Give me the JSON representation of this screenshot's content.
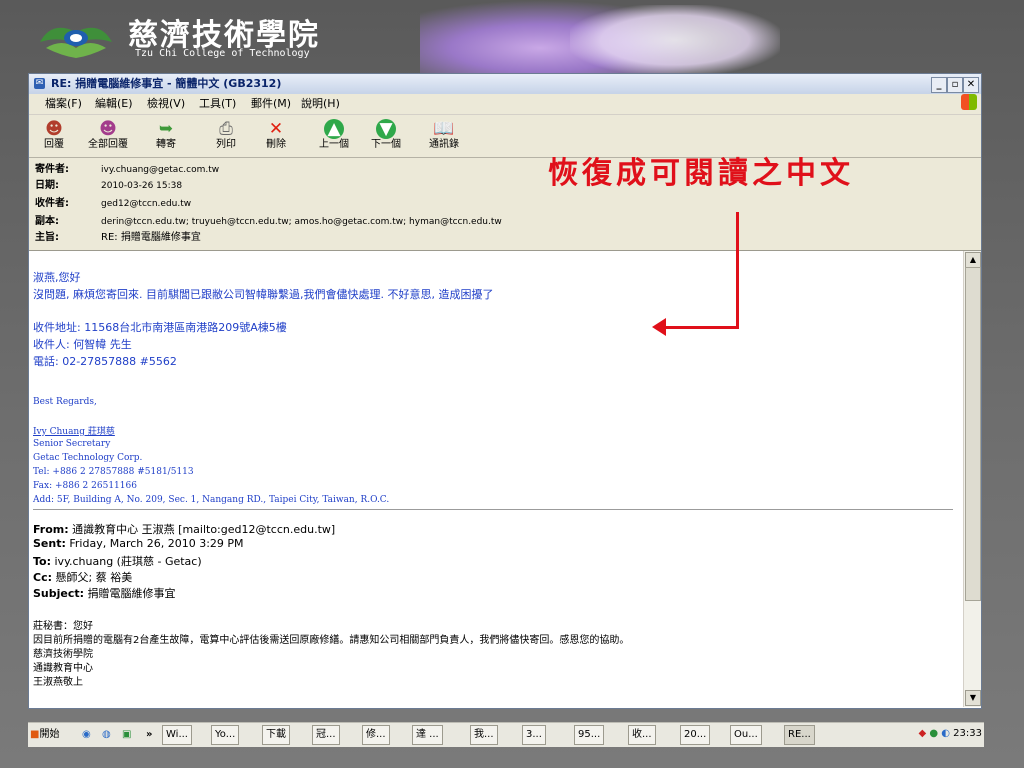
{
  "slide": {
    "logo_cn": "慈濟技術學院",
    "logo_en": "Tzu Chi College of Technology",
    "overlay_text": "恢復成可閱讀之中文"
  },
  "window": {
    "title": "RE: 捐贈電腦維修事宜 - 簡體中文 (GB2312)",
    "controls": [
      "_",
      "▫",
      "✕"
    ]
  },
  "menu": [
    "檔案(F)",
    "編輯(E)",
    "檢視(V)",
    "工具(T)",
    "郵件(M)",
    "說明(H)"
  ],
  "toolbar": [
    {
      "label": "回覆",
      "icon": "reply-icon"
    },
    {
      "label": "全部回覆",
      "icon": "reply-all-icon"
    },
    {
      "label": "轉寄",
      "icon": "forward-icon"
    },
    {
      "label": "列印",
      "icon": "print-icon"
    },
    {
      "label": "刪除",
      "icon": "delete-icon"
    },
    {
      "label": "上一個",
      "icon": "up-arrow-icon"
    },
    {
      "label": "下一個",
      "icon": "down-arrow-icon"
    },
    {
      "label": "通訊錄",
      "icon": "address-book-icon"
    }
  ],
  "headers": {
    "from_label": "寄件者:",
    "from": "ivy.chuang@getac.com.tw",
    "date_label": "日期:",
    "date": "2010-03-26 15:38",
    "to_label": "收件者:",
    "to": "ged12@tccn.edu.tw",
    "cc_label": "副本:",
    "cc": "derin@tccn.edu.tw; truyueh@tccn.edu.tw; amos.ho@getac.com.tw; hyman@tccn.edu.tw",
    "subject_label": "主旨:",
    "subject": "RE: 捐贈電腦維修事宜"
  },
  "body": {
    "greeting": "淑燕,您好",
    "line1": "沒問題, 麻煩您寄回來. 目前騏閭已跟敝公司智幃聯繫過,我們會儘快處理. 不好意思, 造成困擾了",
    "addr": "收件地址: 11568台北市南港區南港路209號A棟5樓",
    "recipient": "收件人: 何智幃 先生",
    "phone": "電話: 02-27857888 #5562",
    "regards": "Best Regards,",
    "sig_name": "Ivy Chuang 莊琪慈",
    "sig_title": "Senior Secretary",
    "sig_company": "Getac Technology Corp.",
    "sig_tel": "Tel: +886 2 27857888  #5181/5113",
    "sig_fax": "Fax: +886 2 26511166",
    "sig_add": "Add: 5F, Building A, No. 209, Sec. 1, Nangang RD., Taipei City, Taiwan, R.O.C.",
    "q_from_label": "From:",
    "q_from": "通識教育中心 王淑燕 [mailto:ged12@tccn.edu.tw]",
    "q_sent_label": "Sent:",
    "q_sent": "Friday, March 26, 2010 3:29 PM",
    "q_to_label": "To:",
    "q_to": "ivy.chuang (莊琪慈 - Getac)",
    "q_cc_label": "Cc:",
    "q_cc": "懸師父; 蔡 裕美",
    "q_subject_label": "Subject:",
    "q_subject": "捐贈電腦維修事宜",
    "q1": "莊秘書：您好",
    "q2": "因目前所捐贈的電腦有2台產生故障，電算中心評估後需送回原廠修繕。請惠知公司相關部門負責人，我們將儘快寄回。感恩您的協助。",
    "q3": "慈濟技術學院",
    "q4": "通識教育中心",
    "q5": "王淑燕敬上"
  },
  "taskbar": {
    "start": "開始",
    "buttons": [
      "Wi...",
      "Yo...",
      "下載",
      "冠...",
      "修...",
      "達 ...",
      "我...",
      "3...",
      "95...",
      "收...",
      "20...",
      "Ou...",
      "RE..."
    ],
    "time": "23:33"
  }
}
